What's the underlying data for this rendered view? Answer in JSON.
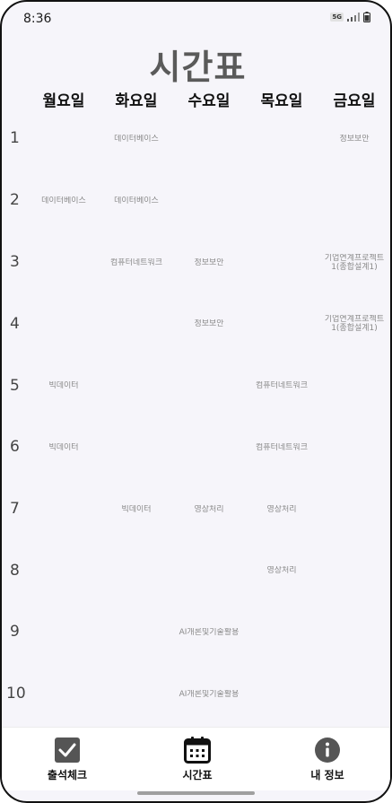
{
  "status_bar": {
    "time": "8:36",
    "network": "5G",
    "icons": [
      "network-icon",
      "signal-icon",
      "battery-icon"
    ]
  },
  "title": "시간표",
  "days": [
    "월요일",
    "화요일",
    "수요일",
    "목요일",
    "금요일"
  ],
  "periods": [
    "1",
    "2",
    "3",
    "4",
    "5",
    "6",
    "7",
    "8",
    "9",
    "10"
  ],
  "timetable": {
    "p1": {
      "mon": "",
      "tue": "데이터베이스",
      "wed": "",
      "thu": "",
      "fri": "정보보안"
    },
    "p2": {
      "mon": "데이터베이스",
      "tue": "데이터베이스",
      "wed": "",
      "thu": "",
      "fri": ""
    },
    "p3": {
      "mon": "",
      "tue": "컴퓨터네트워크",
      "wed": "정보보안",
      "thu": "",
      "fri": "기업연계프로젝트1(종합설계1)"
    },
    "p4": {
      "mon": "",
      "tue": "",
      "wed": "정보보안",
      "thu": "",
      "fri": "기업연계프로젝트1(종합설계1)"
    },
    "p5": {
      "mon": "빅데이터",
      "tue": "",
      "wed": "",
      "thu": "컴퓨터네트워크",
      "fri": ""
    },
    "p6": {
      "mon": "빅데이터",
      "tue": "",
      "wed": "",
      "thu": "컴퓨터네트워크",
      "fri": ""
    },
    "p7": {
      "mon": "",
      "tue": "빅데이터",
      "wed": "영상처리",
      "thu": "영상처리",
      "fri": ""
    },
    "p8": {
      "mon": "",
      "tue": "",
      "wed": "",
      "thu": "영상처리",
      "fri": ""
    },
    "p9": {
      "mon": "",
      "tue": "",
      "wed": "AI개론및기술활용",
      "thu": "",
      "fri": ""
    },
    "p10": {
      "mon": "",
      "tue": "",
      "wed": "AI개론및기술활용",
      "thu": "",
      "fri": ""
    }
  },
  "bottom_nav": {
    "attendance": {
      "label": "출석체크",
      "icon": "checkbox-icon"
    },
    "timetable": {
      "label": "시간표",
      "icon": "calendar-icon"
    },
    "my_info": {
      "label": "내 정보",
      "icon": "info-icon"
    }
  },
  "colors": {
    "background": "#f6f5fa",
    "title": "#5a5a5a",
    "cell_text": "#8a8a8a",
    "nav_icon": "#555555"
  }
}
